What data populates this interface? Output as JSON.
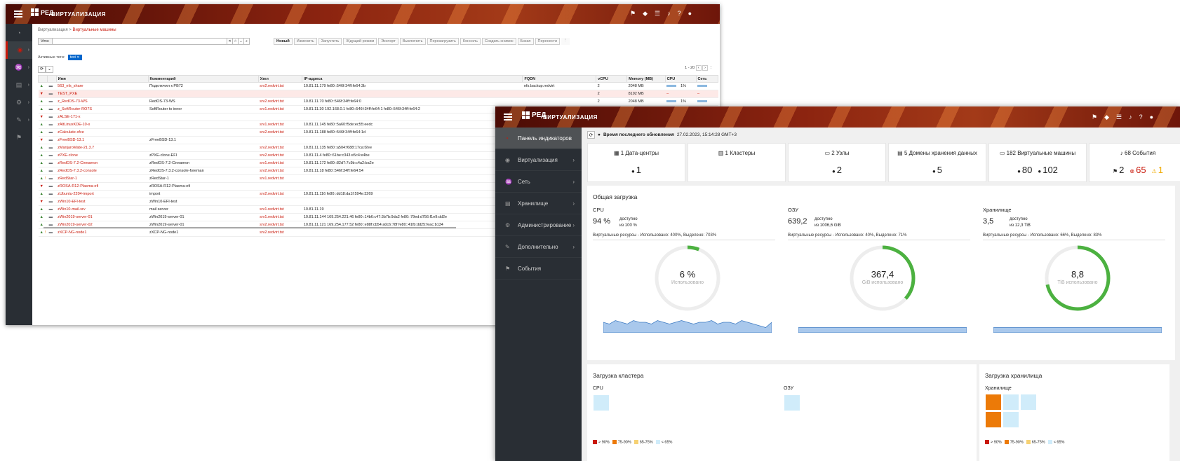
{
  "brand": {
    "logo_text": "РЕД",
    "app_name": "ВИРТУАЛИЗАЦИЯ"
  },
  "colors": {
    "accent": "#c9190b",
    "header_dark": "#6a1108",
    "nav_bg": "#292e34",
    "ok": "#3e8635",
    "warn": "#f0ab00",
    "chart_blue": "#73a5d6"
  },
  "header_icons": [
    "bookmark-icon",
    "tag-icon",
    "tasks-icon",
    "bell-icon",
    "help-icon",
    "user-icon"
  ],
  "vm_window": {
    "nav_icons": [
      "dashboard-icon",
      "virtualization-icon",
      "network-icon",
      "storage-icon",
      "admin-icon",
      "extras-icon",
      "events-icon"
    ],
    "breadcrumb": {
      "root": "Виртуализация",
      "current": "Виртуальные машины"
    },
    "search": {
      "label": "Vms:",
      "value": ""
    },
    "toolbar": [
      "Новый",
      "Изменить",
      "Запустить",
      "Ждущий режим",
      "Экспорт",
      "Выключить",
      "Перезагрузить",
      "Консоль",
      "Создать снимок",
      "Бэкап",
      "Перенести"
    ],
    "active_tags_label": "Активные теги:",
    "active_tag": "test",
    "pagination": "1 - 20",
    "columns": [
      "Имя",
      "Комментарий",
      "Узел",
      "IP-адреса",
      "FQDN",
      "vCPU",
      "Memory (MB)",
      "CPU",
      "Сеть"
    ],
    "rows": [
      {
        "state": "up",
        "name": "563_nfs_share",
        "comment": "Подключил к РВ72",
        "host": "srv2.redvirt.tst",
        "ip": "10.81.11.179 fe80::546f:34ff:fe64:3b",
        "fqdn": "nfs.backup.redvirt",
        "vcpu": "2",
        "mem": "2048 MB",
        "cpu": "1%",
        "net": ""
      },
      {
        "state": "down",
        "name": "TEST_PXE",
        "comment": "",
        "host": "",
        "ip": "",
        "fqdn": "",
        "vcpu": "2",
        "mem": "8192 MB",
        "cpu": "–",
        "net": "–"
      },
      {
        "state": "up",
        "name": "z_RedOS-73-WS",
        "comment": "RedOS-73-WS",
        "host": "srv2.redvirt.tst",
        "ip": "10.81.11.70 fe80::546f:34ff:fe64:0",
        "fqdn": "",
        "vcpu": "2",
        "mem": "2048 MB",
        "cpu": "1%",
        "net": ""
      },
      {
        "state": "up",
        "name": "z_SoftRouter-RO7S",
        "comment": "SoftRouter to inner",
        "host": "srv1.redvirt.tst",
        "ip": "10.81.11.30 192.168.0.1 fe80::546f:34ff:fe64:1 fe80::546f:34ff:fe64:2",
        "fqdn": "",
        "vcpu": "",
        "mem": "",
        "cpu": "",
        "net": ""
      },
      {
        "state": "down",
        "name": "zALSE-171-x",
        "comment": "",
        "host": "",
        "ip": "",
        "fqdn": "",
        "vcpu": "",
        "mem": "",
        "cpu": "",
        "net": ""
      },
      {
        "state": "up",
        "name": "zAltLinuxKDE-10-x",
        "comment": "",
        "host": "srv1.redvirt.tst",
        "ip": "10.81.11.145 fe80::5a60:f5de:ec55:eedc",
        "fqdn": "",
        "vcpu": "",
        "mem": "",
        "cpu": "",
        "net": ""
      },
      {
        "state": "up",
        "name": "zCalculate-xfce",
        "comment": "",
        "host": "srv2.redvirt.tst",
        "ip": "10.81.11.188 fe80::546f:34ff:fe64:1d",
        "fqdn": "",
        "vcpu": "",
        "mem": "",
        "cpu": "",
        "net": ""
      },
      {
        "state": "down",
        "name": "zFreeBSD-13.1",
        "comment": "zFreeBSD-13.1",
        "host": "",
        "ip": "",
        "fqdn": "",
        "vcpu": "",
        "mem": "",
        "cpu": "",
        "net": ""
      },
      {
        "state": "up",
        "name": "zManjaroMate-21.3.7",
        "comment": "",
        "host": "srv2.redvirt.tst",
        "ip": "10.81.11.135 fe80::a504:f688:17ca:f2ee",
        "fqdn": "",
        "vcpu": "",
        "mem": "",
        "cpu": "",
        "net": ""
      },
      {
        "state": "up",
        "name": "zPXE-clone",
        "comment": "zPXE-clone-EFI",
        "host": "srv2.redvirt.tst",
        "ip": "10.81.11.4 fe80::61be:c343:e5c4:e4be",
        "fqdn": "",
        "vcpu": "",
        "mem": "",
        "cpu": "",
        "net": ""
      },
      {
        "state": "up",
        "name": "zRedOS-7.2-Cinnamon",
        "comment": "zRedOS-7.2-Cinnamon",
        "host": "srv1.redvirt.tst",
        "ip": "10.81.11.172 fe80::82d7:7c9b:c4a2:ba2e",
        "fqdn": "",
        "vcpu": "",
        "mem": "",
        "cpu": "",
        "net": ""
      },
      {
        "state": "up",
        "name": "zRedOS-7.3.2-console",
        "comment": "zRedOS-7.3.2-console-foreman",
        "host": "srv2.redvirt.tst",
        "ip": "10.81.11.18 fe80::546f:34ff:fe64:54",
        "fqdn": "",
        "vcpu": "",
        "mem": "",
        "cpu": "",
        "net": ""
      },
      {
        "state": "upw",
        "name": "zRedStar-1",
        "comment": "zRedStar-1",
        "host": "srv1.redvirt.tst",
        "ip": "",
        "fqdn": "",
        "vcpu": "",
        "mem": "",
        "cpu": "",
        "net": ""
      },
      {
        "state": "down",
        "name": "zROSA-R12-Plasma-efi",
        "comment": "zROSA-R12-Plasma-efi",
        "host": "",
        "ip": "",
        "fqdn": "",
        "vcpu": "",
        "mem": "",
        "cpu": "",
        "net": ""
      },
      {
        "state": "up",
        "name": "zUbuntu-2204-import",
        "comment": "import",
        "host": "srv2.redvirt.tst",
        "ip": "10.81.11.116 fe80::dd18:da1f:594e:3269",
        "fqdn": "",
        "vcpu": "",
        "mem": "",
        "cpu": "",
        "net": ""
      },
      {
        "state": "down",
        "name": "zWin10-EFI-test",
        "comment": "zWin10-EFI-test",
        "host": "",
        "ip": "",
        "fqdn": "",
        "vcpu": "",
        "mem": "",
        "cpu": "",
        "net": ""
      },
      {
        "state": "up",
        "name": "zWin10-mail-srv",
        "comment": "mail server",
        "host": "srv1.redvirt.tst",
        "ip": "10.81.11.19",
        "fqdn": "",
        "vcpu": "",
        "mem": "",
        "cpu": "",
        "net": ""
      },
      {
        "state": "up",
        "name": "zWin2019-server-01",
        "comment": "zWin2019-server-01",
        "host": "srv1.redvirt.tst",
        "ip": "10.81.11.144 169.254.221.46 fe80::14b6:c47:3b7b:9da2 fe80::79ed:d756:f1e9:dd2e",
        "fqdn": "",
        "vcpu": "",
        "mem": "",
        "cpu": "",
        "net": ""
      },
      {
        "state": "up",
        "name": "zWin2019-server-02",
        "comment": "zWin2019-server-01",
        "host": "srv2.redvirt.tst",
        "ip": "10.81.11.121 169.254.177.52 fe80::e88f:cb54:a0c6:78f fe80::41fb:dd25:feac:b134",
        "fqdn": "",
        "vcpu": "",
        "mem": "",
        "cpu": "",
        "net": ""
      },
      {
        "state": "upw",
        "name": "zXCP-NG-node1",
        "comment": "zXCP-NG-node1",
        "host": "srv2.redvirt.tst",
        "ip": "",
        "fqdn": "",
        "vcpu": "",
        "mem": "",
        "cpu": "",
        "net": ""
      }
    ]
  },
  "dash_window": {
    "nav": [
      {
        "icon": "dashboard-icon",
        "label": "Панель индикаторов",
        "active": true,
        "chev": ""
      },
      {
        "icon": "virtualization-icon",
        "label": "Виртуализация",
        "active": false,
        "chev": "›"
      },
      {
        "icon": "network-icon",
        "label": "Сеть",
        "active": false,
        "chev": "›"
      },
      {
        "icon": "storage-icon",
        "label": "Хранилище",
        "active": false,
        "chev": "›"
      },
      {
        "icon": "admin-icon",
        "label": "Администрирование",
        "active": false,
        "chev": "›"
      },
      {
        "icon": "extras-icon",
        "label": "Дополнительно",
        "active": false,
        "chev": "›"
      },
      {
        "icon": "events-icon",
        "label": "События",
        "active": false,
        "chev": ""
      }
    ],
    "update_label": "Время последнего обновления",
    "update_time": "27.02.2023, 15:14:28 GMT+3",
    "cards": [
      {
        "icon": "datacenter-icon",
        "title": "1 Дата-центры",
        "values": [
          "1"
        ]
      },
      {
        "icon": "cluster-icon",
        "title": "1 Кластеры",
        "values": []
      },
      {
        "icon": "host-icon",
        "title": "2 Узлы",
        "values": [
          "2"
        ]
      },
      {
        "icon": "storage-domain-icon",
        "title": "5 Домены хранения данных",
        "values": [
          "5"
        ]
      },
      {
        "icon": "vm-icon",
        "title": "182 Виртуальные машины",
        "values": [
          "80",
          "102"
        ]
      },
      {
        "icon": "bell-icon",
        "title": "68 События",
        "values": [
          "2",
          "65",
          "1"
        ]
      }
    ],
    "utilization_title": "Общая загрузка",
    "utilization": [
      {
        "name": "CPU",
        "big": "94 %",
        "avail_label": "доступно",
        "avail_of": "из 100 %",
        "virtual": "Виртуальные ресурсы - Использовано: 400%, Выделено: 703%",
        "gauge_value": "6 %",
        "gauge_sub": "Использовано",
        "used_fraction": 0.06
      },
      {
        "name": "ОЗУ",
        "big": "639,2",
        "avail_label": "доступно",
        "avail_of": "из 1006,6 GiB",
        "virtual": "Виртуальные ресурсы - Использовано: 40%, Выделено: 71%",
        "gauge_value": "367,4",
        "gauge_sub": "GiB использовано",
        "used_fraction": 0.365
      },
      {
        "name": "Хранилище",
        "big": "3,5",
        "avail_label": "доступно",
        "avail_of": "из 12,3 TiB",
        "virtual": "Виртуальные ресурсы - Использовано: 66%, Выделено: 83%",
        "gauge_value": "8,8",
        "gauge_sub": "TiB использовано",
        "used_fraction": 0.715
      }
    ],
    "cluster_title": "Загрузка кластера",
    "cluster_cpu_label": "CPU",
    "cluster_ram_label": "ОЗУ",
    "storage_title": "Загрузка хранилища",
    "storage_label": "Хранилище",
    "legend": [
      "> 90%",
      "75-90%",
      "65-75%",
      "< 65%"
    ],
    "legend_colors": [
      "#c9190b",
      "#ec7a08",
      "#f6d173",
      "#d0ecfa"
    ]
  }
}
